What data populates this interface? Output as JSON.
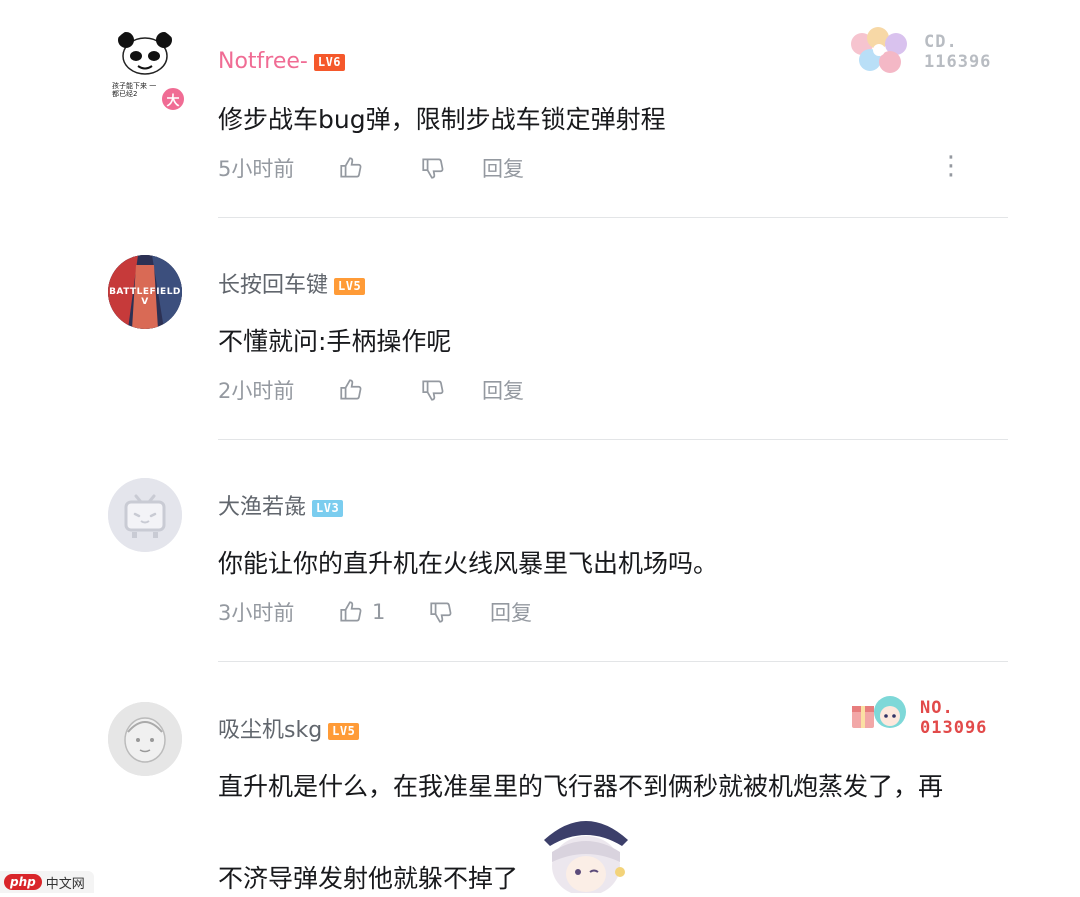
{
  "comments": [
    {
      "username": "Notfree-",
      "level": "LV6",
      "content": "修步战车bug弹，限制步战车锁定弹射程",
      "time": "5小时前",
      "likes": "",
      "reply_label": "回复",
      "more_label": "⋮",
      "avatar_caption": "孩子能下来 一都已经2",
      "avatar_badge": "大",
      "fan_badge": {
        "line1": "CD.",
        "line2": "116396"
      }
    },
    {
      "username": "长按回车键",
      "level": "LV5",
      "content": "不懂就问:手柄操作呢",
      "time": "2小时前",
      "likes": "",
      "reply_label": "回复",
      "avatar_text": "BATTLEFIELD V"
    },
    {
      "username": "大渔若彘",
      "level": "LV3",
      "content": "你能让你的直升机在火线风暴里飞出机场吗。",
      "time": "3小时前",
      "likes": "1",
      "reply_label": "回复"
    },
    {
      "username": "吸尘机skg",
      "level": "LV5",
      "content_line1": "直升机是什么，在我准星里的飞行器不到俩秒就被机炮蒸发了，再",
      "content_line2": "不济导弹发射他就躲不掉了",
      "fan_badge": {
        "line1": "NO.",
        "line2": "013096"
      }
    }
  ],
  "watermark": {
    "logo": "php",
    "text": "中文网"
  },
  "colors": {
    "lv6": "#f5582b",
    "lv5": "#ff9b37",
    "lv3": "#7bcdef",
    "username_vip": "#f06c94",
    "meta": "#9499a0"
  }
}
